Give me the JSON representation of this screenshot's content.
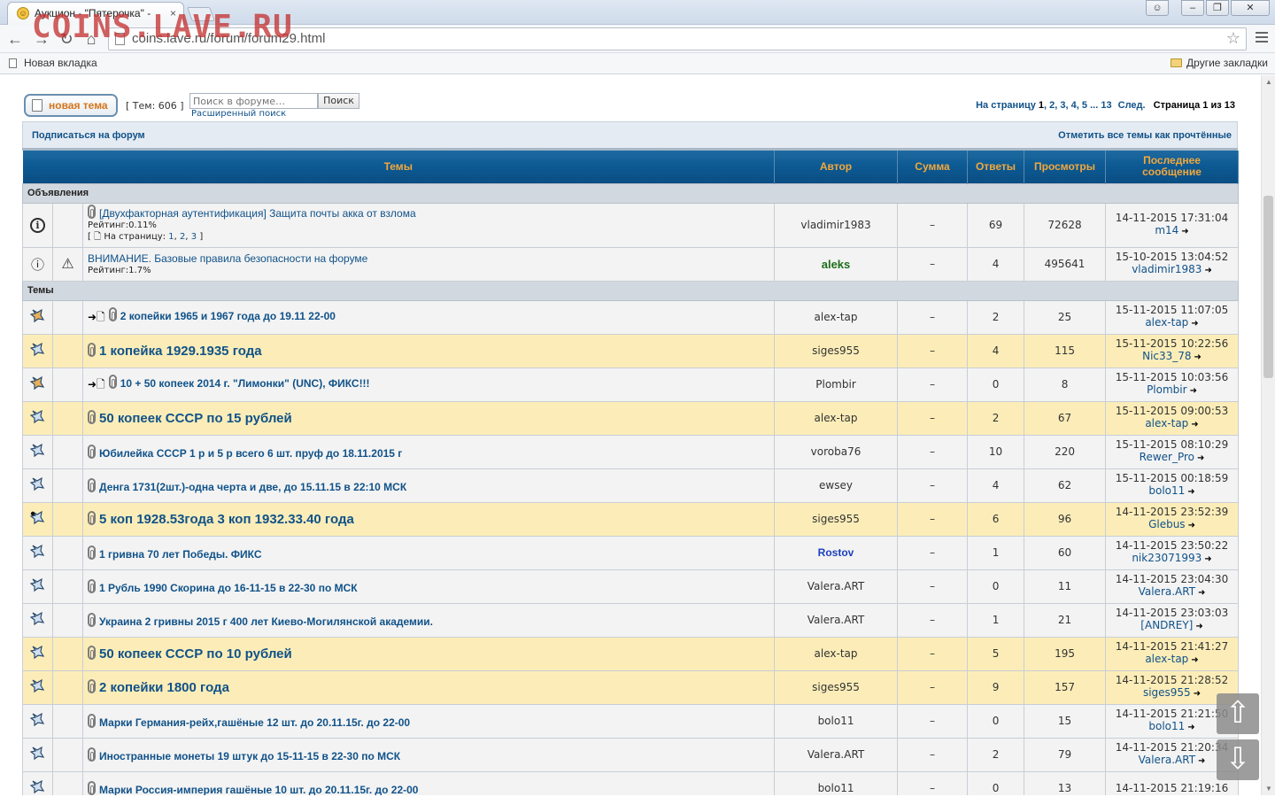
{
  "browser": {
    "tab_title": "Аукцион - \"Пятерочка\" -",
    "url": "coins.lave.ru/forum/forum29.html",
    "watermark": "COINS.LAVE.RU",
    "bookmark_left": "Новая вкладка",
    "bookmark_right": "Другие закладки"
  },
  "toolbar": {
    "new_topic_label": "новая тема",
    "topic_count": "[ Тем: 606 ]",
    "search_placeholder": "Поиск в форуме…",
    "search_button": "Поиск",
    "advanced_search": "Расширенный поиск"
  },
  "pagination": {
    "label": "На страницу",
    "pages": [
      "1",
      "2",
      "3",
      "4",
      "5"
    ],
    "ellipsis": "...",
    "last": "13",
    "next": "След.",
    "page_info": "Страница 1 из 13"
  },
  "subheader": {
    "subscribe": "Подписаться на форум",
    "mark_read": "Отметить все темы как прочтённые"
  },
  "columns": {
    "topics": "Темы",
    "author": "Автор",
    "sum": "Сумма",
    "replies": "Ответы",
    "views": "Просмотры",
    "last_post_1": "Последнее",
    "last_post_2": "сообщение"
  },
  "sections": {
    "announcements": "Объявления",
    "topics": "Темы"
  },
  "announcements": [
    {
      "title": "[Двухфакторная аутентификация] Защита почты акка от взлома",
      "rating": "Рейтинг:0.11%",
      "pages_prefix": "[",
      "pages_label": "На страницу:",
      "pages": [
        "1",
        "2",
        "3"
      ],
      "pages_suffix": "]",
      "author": "vladimir1983",
      "sum": "–",
      "replies": "69",
      "views": "72628",
      "last_date": "14-11-2015 17:31:04",
      "last_by": "m14"
    },
    {
      "title": "ВНИМАНИЕ. Базовые правила безопасности на форуме",
      "rating": "Рейтинг:1.7%",
      "author": "aleks",
      "sum": "–",
      "replies": "4",
      "views": "495641",
      "last_date": "15-10-2015 13:04:52",
      "last_by": "vladimir1983"
    }
  ],
  "topics": [
    {
      "title": "2 копейки 1965 и 1967 года до 19.11 22-00",
      "author": "alex-tap",
      "sum": "–",
      "replies": "2",
      "views": "25",
      "last_date": "15-11-2015 11:07:05",
      "last_by": "alex-tap"
    },
    {
      "title": "1 копейка 1929.1935 года",
      "author": "siges955",
      "sum": "–",
      "replies": "4",
      "views": "115",
      "last_date": "15-11-2015 10:22:56",
      "last_by": "Nic33_78"
    },
    {
      "title": "10 + 50 копеек 2014 г. \"Лимонки\" (UNC), ФИКС!!!",
      "author": "Plombir",
      "sum": "–",
      "replies": "0",
      "views": "8",
      "last_date": "15-11-2015 10:03:56",
      "last_by": "Plombir"
    },
    {
      "title": "50 копеек СССР по 15 рублей",
      "author": "alex-tap",
      "sum": "–",
      "replies": "2",
      "views": "67",
      "last_date": "15-11-2015 09:00:53",
      "last_by": "alex-tap"
    },
    {
      "title": "Юбилейка СССР 1 р и 5 р всего 6 шт. пруф до 18.11.2015 г",
      "author": "voroba76",
      "sum": "–",
      "replies": "10",
      "views": "220",
      "last_date": "15-11-2015 08:10:29",
      "last_by": "Rewer_Pro"
    },
    {
      "title": "Денга 1731(2шт.)-одна черта и две, до 15.11.15 в 22:10 МСК",
      "author": "ewsey",
      "sum": "–",
      "replies": "4",
      "views": "62",
      "last_date": "15-11-2015 00:18:59",
      "last_by": "bolo11"
    },
    {
      "title": "5 коп 1928.53года 3 коп 1932.33.40 года",
      "author": "siges955",
      "sum": "–",
      "replies": "6",
      "views": "96",
      "last_date": "14-11-2015 23:52:39",
      "last_by": "Glebus"
    },
    {
      "title": "1 гривна 70 лет Победы. ФИКС",
      "author": "Rostov",
      "sum": "–",
      "replies": "1",
      "views": "60",
      "last_date": "14-11-2015 23:50:22",
      "last_by": "nik23071993"
    },
    {
      "title": "1 Рубль 1990 Скорина до 16-11-15 в 22-30 по МСК",
      "author": "Valera.ART",
      "sum": "–",
      "replies": "0",
      "views": "11",
      "last_date": "14-11-2015 23:04:30",
      "last_by": "Valera.ART"
    },
    {
      "title": "Украина 2 гривны 2015 г 400 лет Киево-Могилянской академии.",
      "author": "Valera.ART",
      "sum": "–",
      "replies": "1",
      "views": "21",
      "last_date": "14-11-2015 23:03:03",
      "last_by": "[ANDREY]"
    },
    {
      "title": "50 копеек СССР по 10 рублей",
      "author": "alex-tap",
      "sum": "–",
      "replies": "5",
      "views": "195",
      "last_date": "14-11-2015 21:41:27",
      "last_by": "alex-tap"
    },
    {
      "title": "2 копейки 1800 года",
      "author": "siges955",
      "sum": "–",
      "replies": "9",
      "views": "157",
      "last_date": "14-11-2015 21:28:52",
      "last_by": "siges955"
    },
    {
      "title": "Марки Германия-рейх,гашёные 12 шт. до 20.11.15г. до 22-00",
      "author": "bolo11",
      "sum": "–",
      "replies": "0",
      "views": "15",
      "last_date": "14-11-2015 21:21:50",
      "last_by": "bolo11"
    },
    {
      "title": "Иностранные монеты 19 штук до 15-11-15 в 22-30 по МСК",
      "author": "Valera.ART",
      "sum": "–",
      "replies": "2",
      "views": "79",
      "last_date": "14-11-2015 21:20:34",
      "last_by": "Valera.ART"
    },
    {
      "title": "Марки Россия-империя гашёные 10 шт. до 20.11.15г. до 22-00",
      "author": "bolo11",
      "sum": "–",
      "replies": "0",
      "views": "13",
      "last_date": "14-11-2015 21:19:16",
      "last_by": ""
    }
  ],
  "float_buttons": {
    "up": "⇧",
    "down": "⇩"
  },
  "colors": {
    "link": "#105289",
    "header_bg": "#0d5a94",
    "header_text": "#f3a83b",
    "hot_row": "#fcedb8",
    "new_topic_text": "#d6751a"
  }
}
